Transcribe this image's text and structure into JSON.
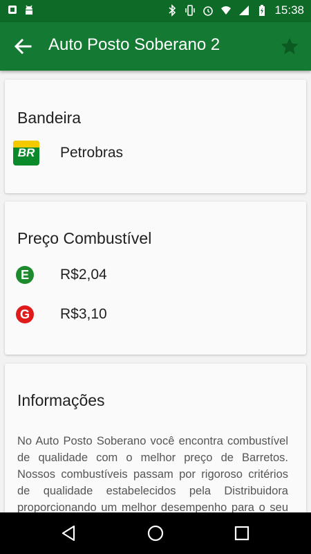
{
  "status_bar": {
    "time": "15:38",
    "icons": [
      "notification-icon",
      "android-icon",
      "bluetooth-icon",
      "vibrate-icon",
      "alarm-icon",
      "wifi-icon",
      "signal-icon",
      "battery-icon"
    ]
  },
  "app_bar": {
    "title": "Auto Posto Soberano 2",
    "back_icon": "arrow-left-icon",
    "favorite_icon": "star-icon"
  },
  "flag_card": {
    "heading": "Bandeira",
    "brand_logo_text": "BR",
    "brand_name": "Petrobras"
  },
  "price_card": {
    "heading": "Preço Combustível",
    "items": [
      {
        "badge": "E",
        "price": "R$2,04",
        "color": "#1e8a2e"
      },
      {
        "badge": "G",
        "price": "R$3,10",
        "color": "#e01b1b"
      }
    ]
  },
  "info_card": {
    "heading": "Informações",
    "text": "No Auto Posto Soberano você encontra combustível de qualidade com o melhor preço de Barretos. Nossos combustíveis passam por rigoroso critérios de qualidade estabelecidos pela Distribuidora proporcionando um melhor desempenho para o seu veículo. Venha nos visitar."
  },
  "nav_bar": {
    "back_icon": "triangle-back-icon",
    "home_icon": "circle-home-icon",
    "recents_icon": "square-recents-icon"
  },
  "colors": {
    "primary": "#147a33",
    "primary_dark": "#0d6a27",
    "ethanol": "#1e8a2e",
    "gasoline": "#e01b1b"
  }
}
